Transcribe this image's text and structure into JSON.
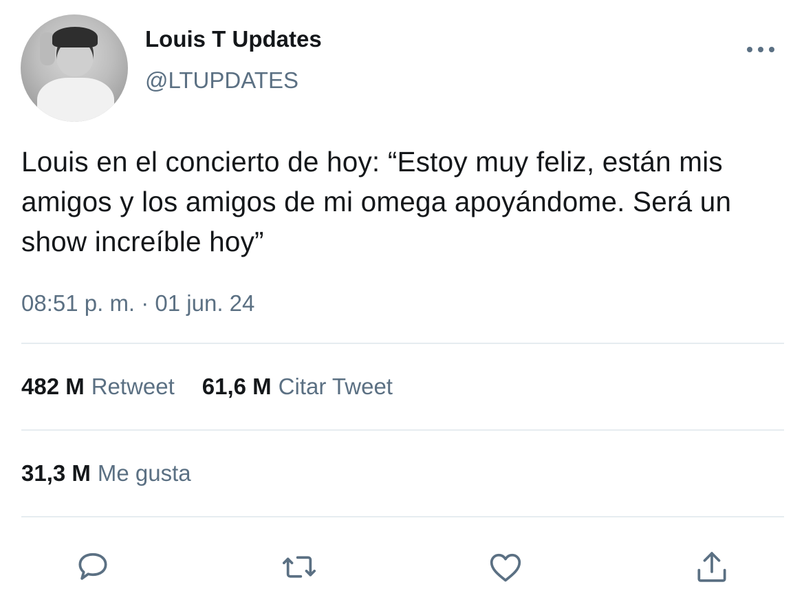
{
  "tweet": {
    "display_name": "Louis T Updates",
    "handle": "@LTUPDATES",
    "text": "Louis en el concierto de hoy: “Estoy muy feliz, están mis amigos y los amigos de mi omega apoyándome. Será un show increíble hoy”",
    "timestamp": "08:51 p. m. · 01 jun. 24"
  },
  "stats": {
    "retweets_count": "482 M",
    "retweets_label": "Retweet",
    "quotes_count": "61,6 M",
    "quotes_label": "Citar Tweet",
    "likes_count": "31,3 M",
    "likes_label": "Me gusta"
  },
  "icons": {
    "more": "more-dots-icon",
    "reply": "reply-bubble-icon",
    "retweet": "retweet-icon",
    "like": "heart-icon",
    "share": "share-upload-icon"
  },
  "colors": {
    "text_primary": "#14171a",
    "text_secondary": "#5b7083",
    "divider": "#e6ecf0",
    "icon": "#5b7083"
  }
}
